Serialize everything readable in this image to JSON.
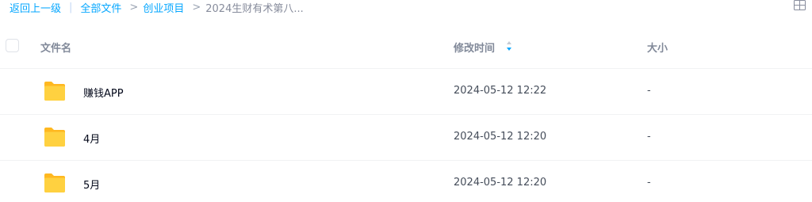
{
  "breadcrumb": {
    "back": "返回上一级",
    "root": "全部文件",
    "level1": "创业项目",
    "current": "2024生财有术第八..."
  },
  "header": {
    "name": "文件名",
    "modified": "修改时间",
    "size": "大小"
  },
  "files": [
    {
      "name": "赚钱APP",
      "modified": "2024-05-12 12:22",
      "size": "-",
      "icon": "folder-icon"
    },
    {
      "name": "4月",
      "modified": "2024-05-12 12:20",
      "size": "-",
      "icon": "folder-icon"
    },
    {
      "name": "5月",
      "modified": "2024-05-12 12:20",
      "size": "-",
      "icon": "folder-icon"
    }
  ],
  "colors": {
    "accent": "#06a7ff",
    "folder": "#ffc636",
    "text_primary": "#03081a",
    "text_secondary": "#454d5a",
    "header_text": "#818999"
  }
}
